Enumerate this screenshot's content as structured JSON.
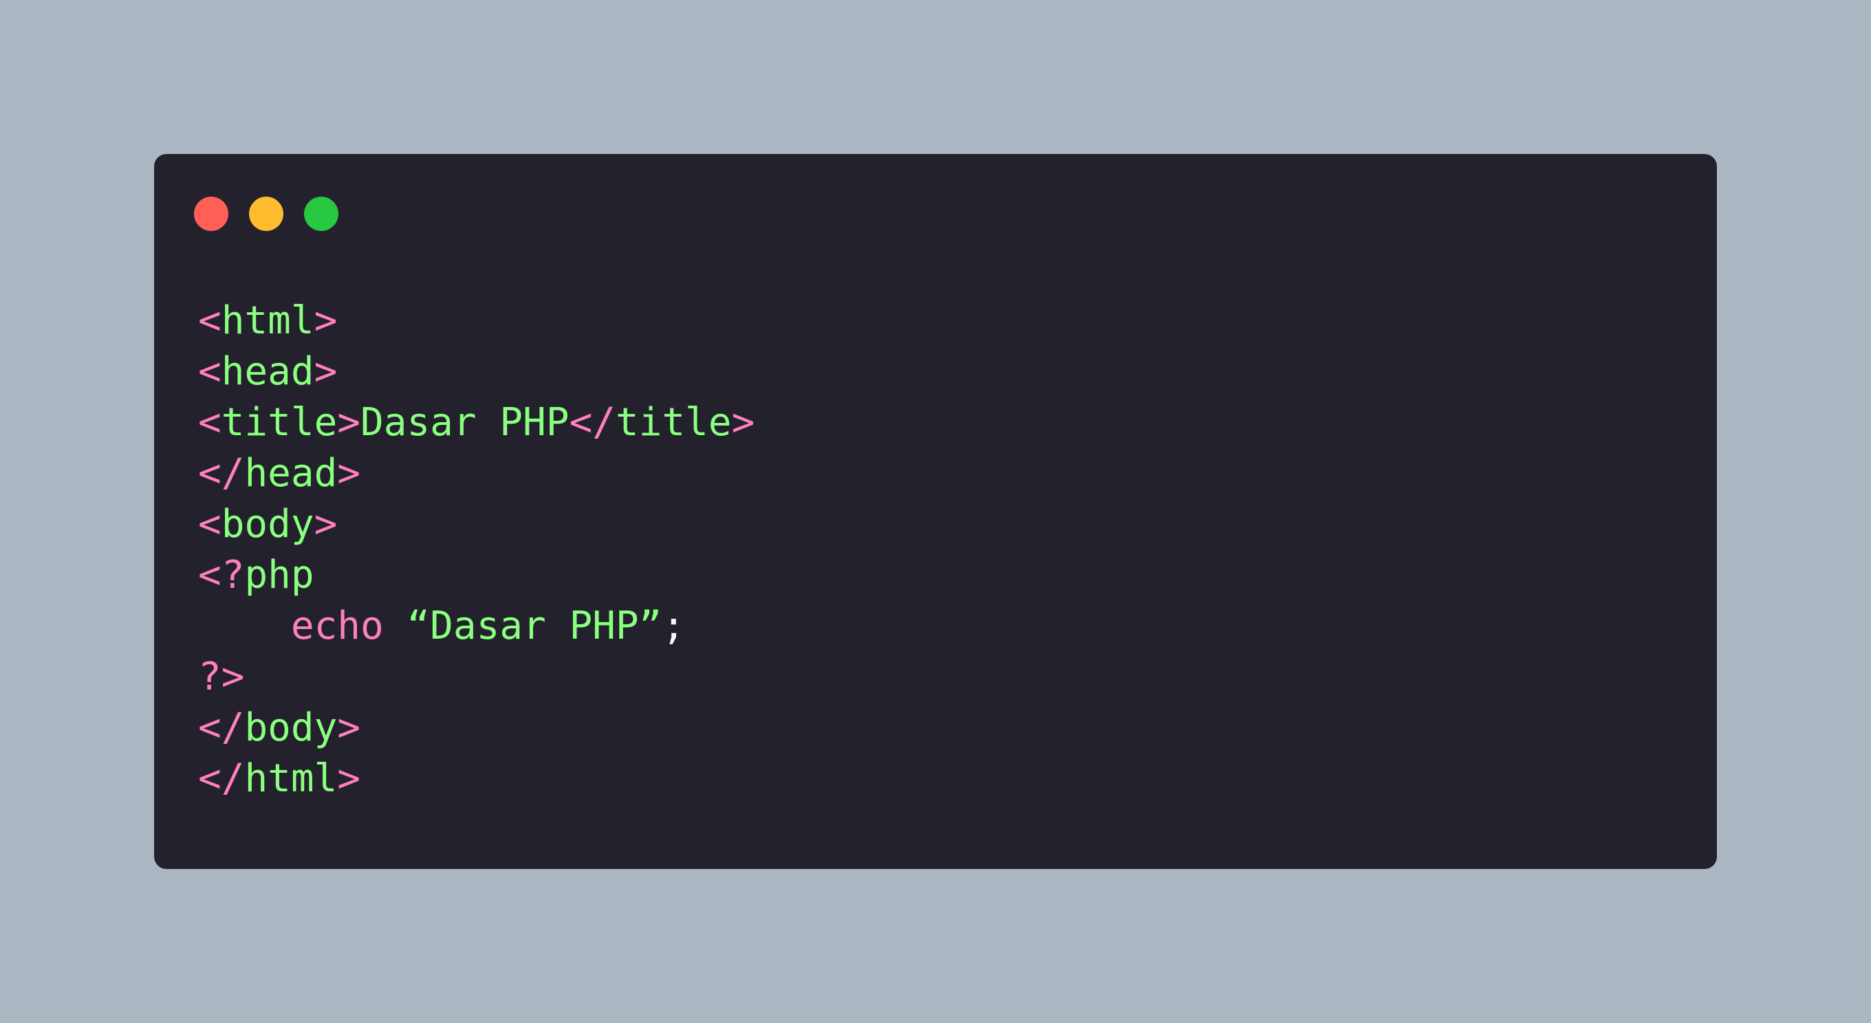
{
  "colors": {
    "background": "#abb8c3",
    "window": "#22212c",
    "close": "#ff5f57",
    "minimize": "#febc2e",
    "maximize": "#28c840",
    "punctuation": "#ff80bf",
    "tag": "#8aff80",
    "plain": "#f8f8f2"
  },
  "window_controls": [
    {
      "name": "close-dot"
    },
    {
      "name": "minimize-dot"
    },
    {
      "name": "maximize-dot"
    }
  ],
  "code_lines": [
    [
      {
        "t": "<",
        "c": "p"
      },
      {
        "t": "html",
        "c": "g"
      },
      {
        "t": ">",
        "c": "p"
      }
    ],
    [
      {
        "t": "<",
        "c": "p"
      },
      {
        "t": "head",
        "c": "g"
      },
      {
        "t": ">",
        "c": "p"
      }
    ],
    [
      {
        "t": "<",
        "c": "p"
      },
      {
        "t": "title",
        "c": "g"
      },
      {
        "t": ">",
        "c": "p"
      },
      {
        "t": "Dasar PHP",
        "c": "g"
      },
      {
        "t": "</",
        "c": "p"
      },
      {
        "t": "title",
        "c": "g"
      },
      {
        "t": ">",
        "c": "p"
      }
    ],
    [
      {
        "t": "</",
        "c": "p"
      },
      {
        "t": "head",
        "c": "g"
      },
      {
        "t": ">",
        "c": "p"
      }
    ],
    [
      {
        "t": "<",
        "c": "p"
      },
      {
        "t": "body",
        "c": "g"
      },
      {
        "t": ">",
        "c": "p"
      }
    ],
    [
      {
        "t": "<?",
        "c": "p"
      },
      {
        "t": "php",
        "c": "g"
      }
    ],
    [
      {
        "t": "    ",
        "c": "w"
      },
      {
        "t": "echo",
        "c": "p"
      },
      {
        "t": " ",
        "c": "w"
      },
      {
        "t": "“Dasar PHP”",
        "c": "g"
      },
      {
        "t": ";",
        "c": "w"
      }
    ],
    [
      {
        "t": "?>",
        "c": "p"
      }
    ],
    [
      {
        "t": "</",
        "c": "p"
      },
      {
        "t": "body",
        "c": "g"
      },
      {
        "t": ">",
        "c": "p"
      }
    ],
    [
      {
        "t": "</",
        "c": "p"
      },
      {
        "t": "html",
        "c": "g"
      },
      {
        "t": ">",
        "c": "p"
      }
    ]
  ]
}
